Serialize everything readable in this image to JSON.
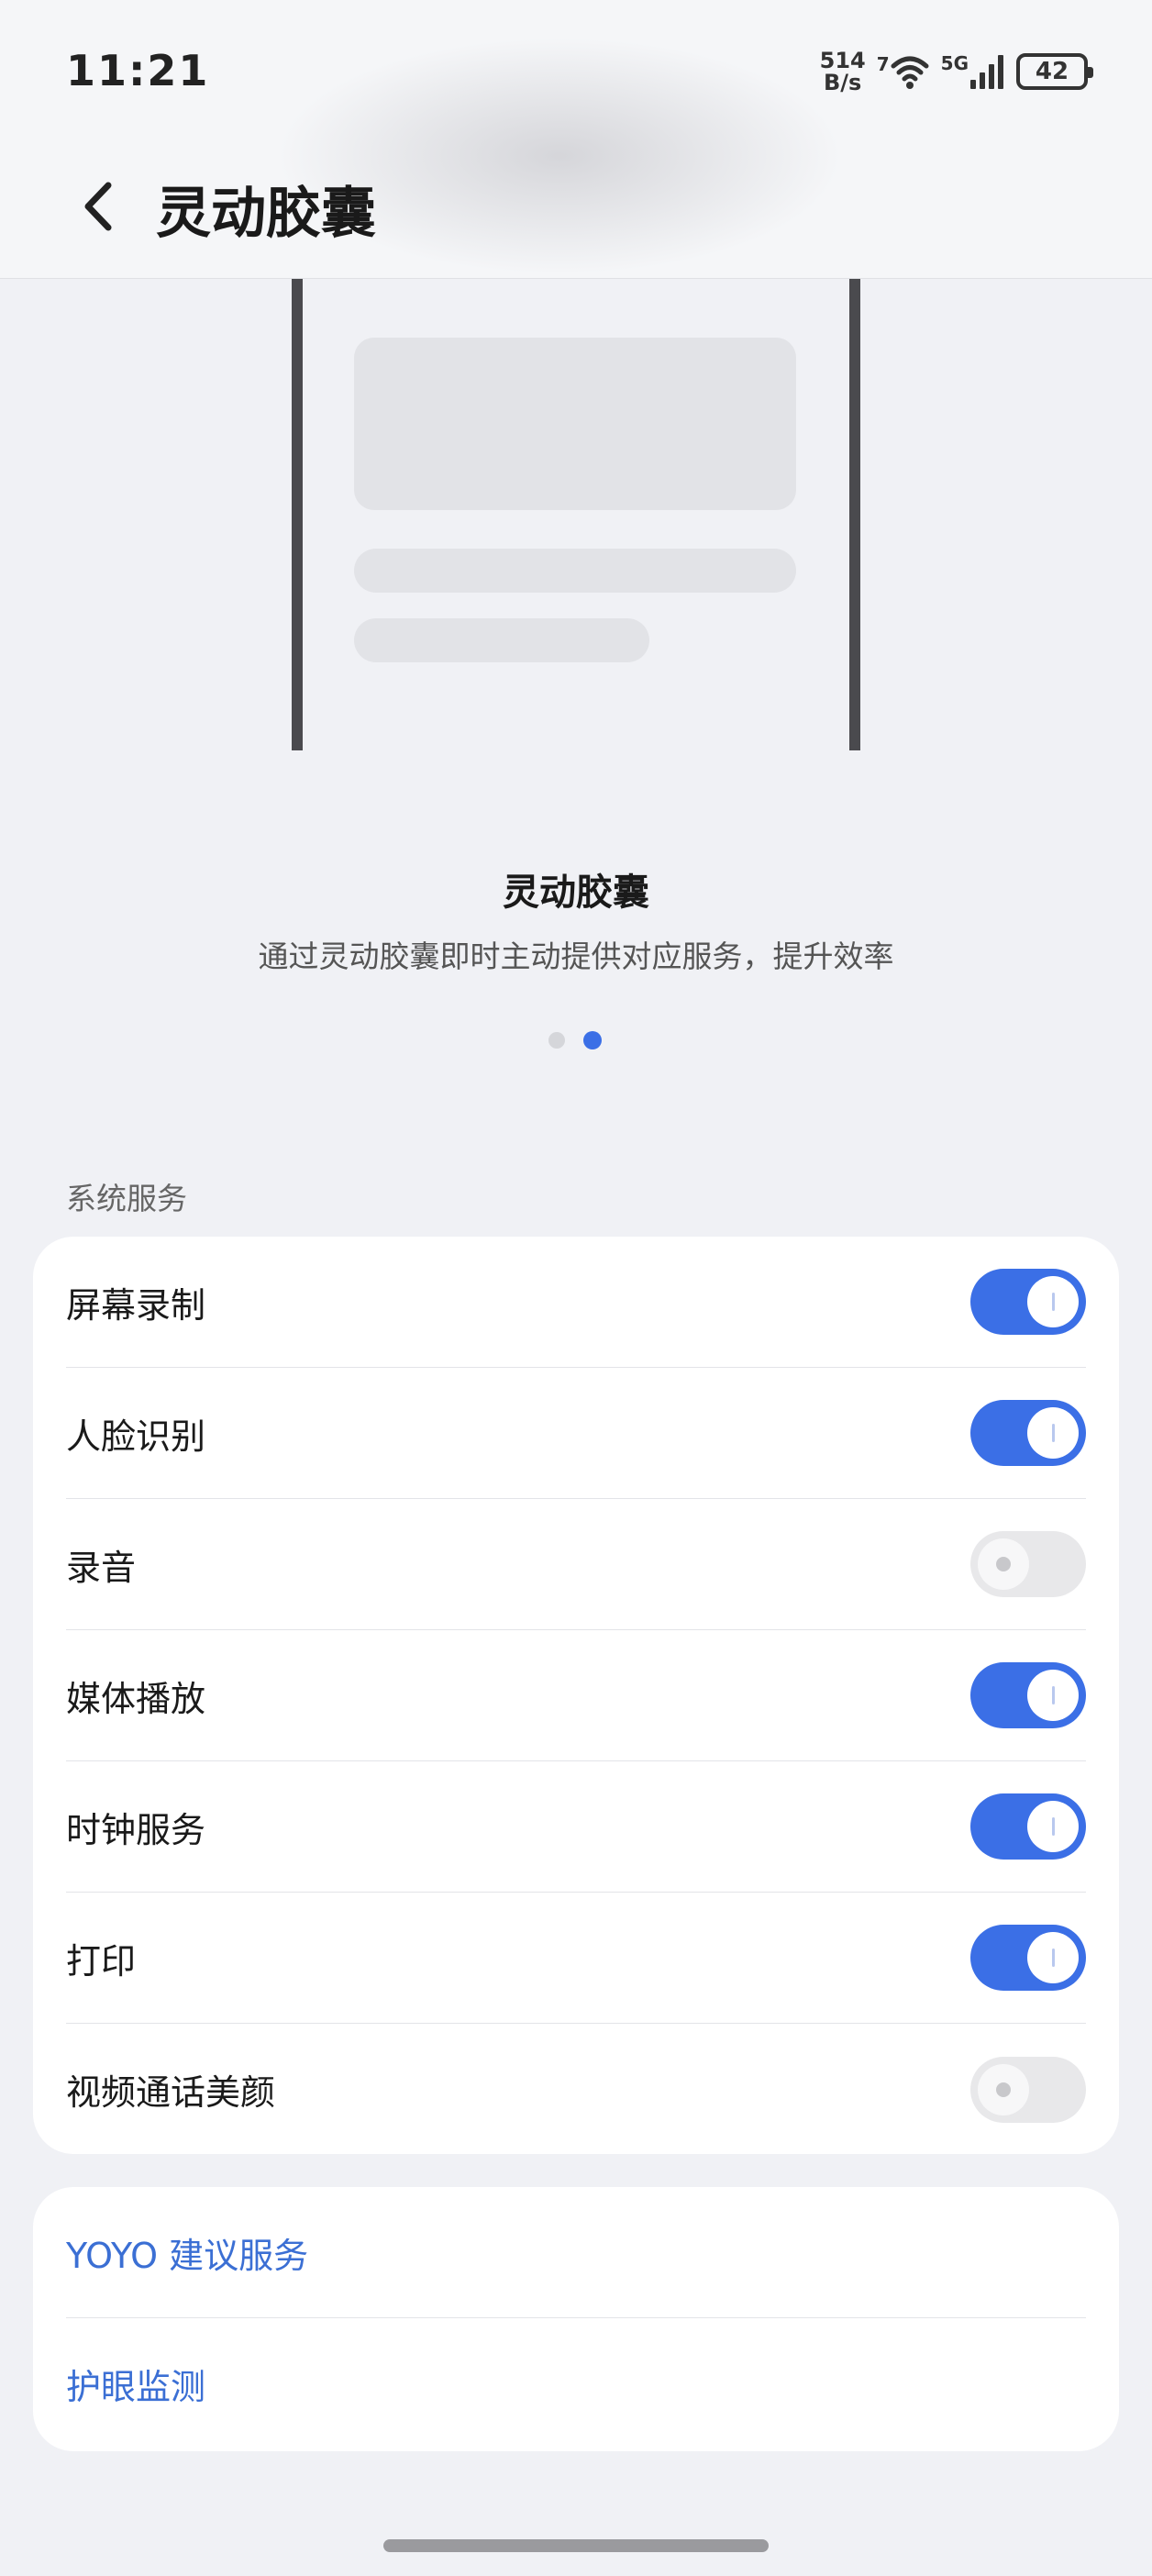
{
  "status_bar": {
    "time": "11:21",
    "speed_value": "514",
    "speed_unit": "B/s",
    "wifi_label": "7",
    "network_type": "5G",
    "battery_level": "42"
  },
  "header": {
    "title": "灵动胶囊"
  },
  "intro": {
    "title": "灵动胶囊",
    "description": "通过灵动胶囊即时主动提供对应服务，提升效率",
    "pager_total": 2,
    "pager_active": 2
  },
  "system_services": {
    "section_label": "系统服务",
    "items": [
      {
        "label": "屏幕录制",
        "enabled": true
      },
      {
        "label": "人脸识别",
        "enabled": true
      },
      {
        "label": "录音",
        "enabled": false
      },
      {
        "label": "媒体播放",
        "enabled": true
      },
      {
        "label": "时钟服务",
        "enabled": true
      },
      {
        "label": "打印",
        "enabled": true
      },
      {
        "label": "视频通话美颜",
        "enabled": false
      }
    ]
  },
  "links": [
    {
      "label": "YOYO 建议服务"
    },
    {
      "label": "护眼监测"
    }
  ],
  "colors": {
    "accent": "#3b6fe6",
    "link": "#3b6fd4",
    "background": "#f0f1f5",
    "card": "#ffffff"
  }
}
